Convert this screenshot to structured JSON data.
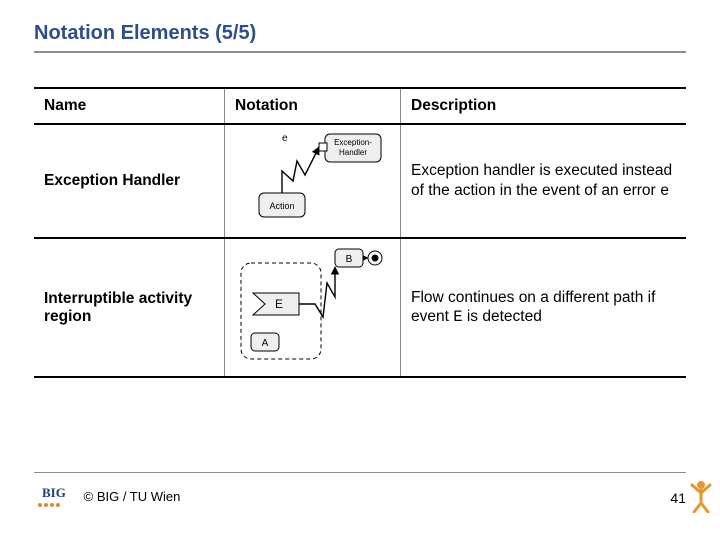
{
  "title": "Notation Elements (5/5)",
  "columns": {
    "name": "Name",
    "notation": "Notation",
    "description": "Description"
  },
  "rows": [
    {
      "name": "Exception Handler",
      "figure": {
        "error_label": "e",
        "handler_label": "Exception-\nHandler",
        "action_label": "Action"
      },
      "description_before": "Exception handler is executed instead of the action in the event of an error ",
      "description_code": "e"
    },
    {
      "name": "Interruptible activity region",
      "figure": {
        "region_event": "E",
        "inner_a": "A",
        "outer_b": "B"
      },
      "description_before": "Flow continues on a different path if event ",
      "description_code": "E",
      "description_after": " is detected"
    }
  ],
  "footer": {
    "copyright": "© BIG / TU Wien",
    "page": "41",
    "logo_text": "BIG"
  }
}
